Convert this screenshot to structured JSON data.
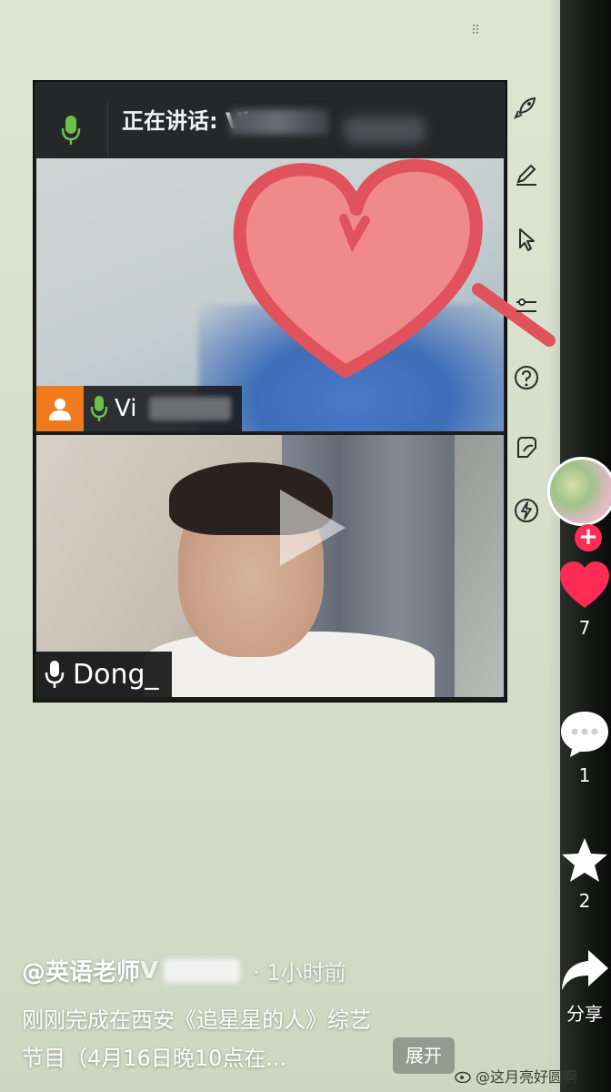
{
  "meeting": {
    "speaking_label": "正在讲话: Vi",
    "participant_top_name": "Vi",
    "participant_bottom_name": "Dong_"
  },
  "feed": {
    "likes": "7",
    "comments": "1",
    "favorites": "2",
    "share_label": "分享",
    "author": "@英语老师",
    "author_suffix": "V",
    "time_ago": "· 1小时前",
    "caption_line1": "刚刚完成在西安《追星星的人》综艺",
    "caption_line2": "节目（4月16日晚10点在...",
    "expand_label": "展开",
    "follow_plus": "+",
    "watermark": "@这月亮好圆啊"
  },
  "colors": {
    "like_red": "#fe2c55",
    "orange_user": "#f07b1e",
    "mic_green": "#6cc04a",
    "heart_fill": "#f08a8a",
    "heart_stroke": "#e0525c"
  },
  "icons": [
    "rocket-icon",
    "pen-icon",
    "cursor-icon",
    "settings-slider-icon",
    "help-icon",
    "sticker-icon",
    "bolt-icon",
    "heart-icon",
    "comment-icon",
    "star-icon",
    "share-icon",
    "microphone-icon",
    "user-icon",
    "play-icon"
  ]
}
